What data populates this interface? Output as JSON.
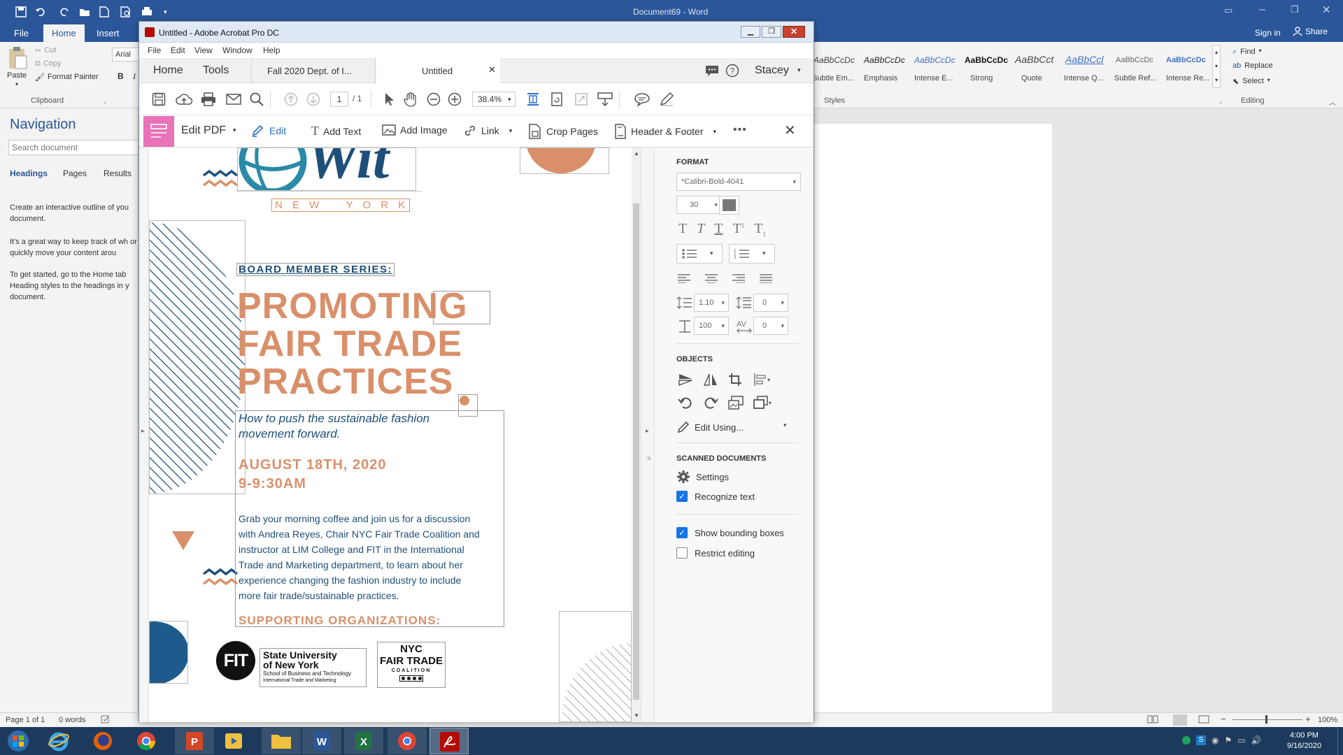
{
  "word": {
    "title": "Document69 - Word",
    "tabs": [
      "File",
      "Home",
      "Insert"
    ],
    "active_tab": "Home",
    "sign_in": "Sign in",
    "share": "Share",
    "clipboard": {
      "paste": "Paste",
      "cut": "Cut",
      "copy": "Copy",
      "format_painter": "Format Painter",
      "group": "Clipboard"
    },
    "font_name": "Arial",
    "bold": "B",
    "italic": "I",
    "styles": [
      "AaBbCcDc",
      "AaBbCcDc",
      "AaBbCcDc",
      "AaBbCcDc",
      "AaBbCct",
      "AaBbCcl",
      "AaBbCcDc",
      "AaBbCcDc"
    ],
    "style_names": [
      "Subtle Em...",
      "Emphasis",
      "Intense E...",
      "Strong",
      "Quote",
      "Intense Q...",
      "Subtle Ref...",
      "Intense Re..."
    ],
    "styles_group": "Styles",
    "editing": {
      "find": "Find",
      "replace": "Replace",
      "select": "Select",
      "group": "Editing"
    },
    "navigation": {
      "title": "Navigation",
      "search_placeholder": "Search document",
      "tabs": [
        "Headings",
        "Pages",
        "Results"
      ],
      "text1": "Create an interactive outline of you document.",
      "text2": "It's a great way to keep track of wh or quickly move your content arou",
      "text3": "To get started, go to the Home tab Heading styles to the headings in y document."
    },
    "status": {
      "page": "Page 1 of 1",
      "words": "0 words",
      "zoom": "100%"
    }
  },
  "acrobat": {
    "title": "Untitled - Adobe Acrobat Pro DC",
    "menu": [
      "File",
      "Edit",
      "View",
      "Window",
      "Help"
    ],
    "tabs": {
      "home": "Home",
      "tools": "Tools",
      "doc1": "Fall 2020 Dept. of I...",
      "doc2": "Untitled"
    },
    "user": "Stacey",
    "page_current": "1",
    "page_total": "/ 1",
    "zoom": "38.4%",
    "edit_bar": {
      "edit_pdf": "Edit PDF",
      "edit": "Edit",
      "add_text": "Add Text",
      "add_image": "Add Image",
      "link": "Link",
      "crop": "Crop Pages",
      "header_footer": "Header & Footer"
    },
    "panel": {
      "format": "FORMAT",
      "font": "*Calibri-Bold-4041",
      "size": "30",
      "line_spacing": "1.10",
      "para_spacing": "0",
      "scale": "100",
      "char_spacing": "0",
      "objects": "OBJECTS",
      "edit_using": "Edit Using...",
      "scanned": "SCANNED DOCUMENTS",
      "settings": "Settings",
      "recognize": "Recognize text",
      "show_boxes": "Show bounding boxes",
      "restrict": "Restrict editing",
      "recognize_checked": true,
      "show_boxes_checked": true,
      "restrict_checked": false
    },
    "pdf": {
      "logo": "Wit",
      "new_york": "N E W   Y O R K",
      "series": "BOARD MEMBER SERIES:",
      "headline1": "PROMOTING",
      "headline2": "FAIR TRADE",
      "headline3": "PRACTICES",
      "subtitle1": "How to push the sustainable fashion",
      "subtitle2": "movement forward.",
      "date1": "AUGUST 18TH, 2020",
      "date2": "9-9:30AM",
      "body": [
        "Grab your morning coffee and join us for a discussion",
        "with Andrea Reyes, Chair NYC Fair Trade Coalition and",
        "instructor at LIM College and FIT in the International",
        "Trade and Marketing department, to learn about her",
        "experience changing the fashion industry to include",
        "more fair trade/sustainable practices."
      ],
      "supporting": "SUPPORTING ORGANIZATIONS:",
      "fit": "FIT",
      "suny1": "State University",
      "suny2": "of New York",
      "suny3": "School of Business and Technology",
      "suny4": "International Trade and Marketing",
      "nyc1": "NYC",
      "nyc2": "FAIR TRADE",
      "nyc3": "COALITION"
    }
  },
  "taskbar": {
    "time": "4:00 PM",
    "date": "9/16/2020"
  },
  "colors": {
    "word_blue": "#2b579a",
    "orange": "#d9906a",
    "navy": "#1e4f7a",
    "teal": "#2a8aa8"
  }
}
